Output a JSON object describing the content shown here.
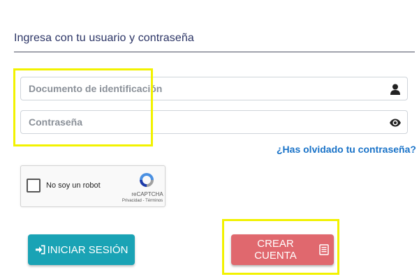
{
  "login": {
    "heading": "Ingresa con tu usuario y contraseña",
    "document_field": {
      "placeholder": "Documento de identificación",
      "value": "",
      "icon": "user-icon"
    },
    "password_field": {
      "placeholder": "Contraseña",
      "value": "",
      "icon": "eye-icon"
    },
    "forgot_password_link": "¿Has olvidado tu contraseña?",
    "recaptcha": {
      "label": "No soy un robot",
      "brand": "reCAPTCHA",
      "links": "Privacidad - Términos",
      "checked": false
    },
    "login_button": {
      "label": "INICIAR SESIÓN",
      "icon": "sign-in-icon"
    },
    "create_account_button": {
      "label": "CREAR CUENTA",
      "icon": "list-icon"
    }
  },
  "colors": {
    "heading": "#2c3566",
    "link": "#1a73c8",
    "login_button": "#1aa3b5",
    "create_button": "#e0686e",
    "highlight": "#f2f200"
  }
}
